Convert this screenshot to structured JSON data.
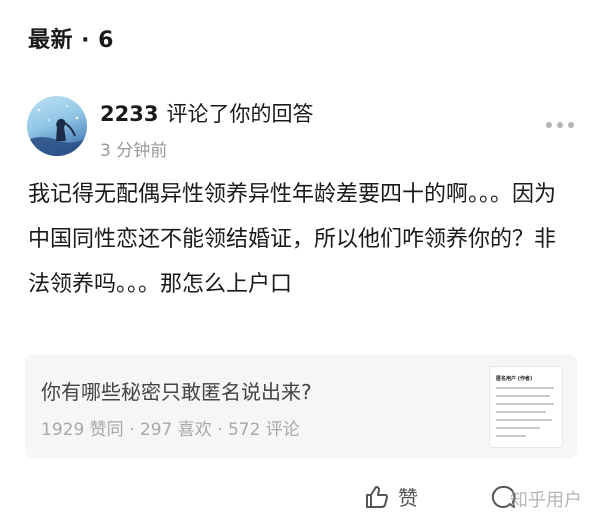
{
  "header": {
    "section_title": "最新 · 6"
  },
  "notification": {
    "username": "2233",
    "action": "评论了你的回答",
    "time": "3 分钟前",
    "comment": "我记得无配偶异性领养异性年龄差要四十的啊。。。因为中国同性恋还不能领结婚证，所以他们咋领养你的？非法领养吗。。。那怎么上户口"
  },
  "question_card": {
    "title": "你有哪些秘密只敢匿名说出来?",
    "stats": "1929 赞同 · 297 喜欢 · 572 评论",
    "thumbnail_heading": "匿名用户 (作者)"
  },
  "actions": {
    "like_label": "赞"
  },
  "watermark": "知乎用户",
  "colors": {
    "text": "#1a1a1a",
    "muted": "#9a9a9a",
    "card_bg": "#f6f6f6"
  },
  "icons": [
    "more-icon",
    "thumbs-up-icon",
    "comment-icon"
  ]
}
